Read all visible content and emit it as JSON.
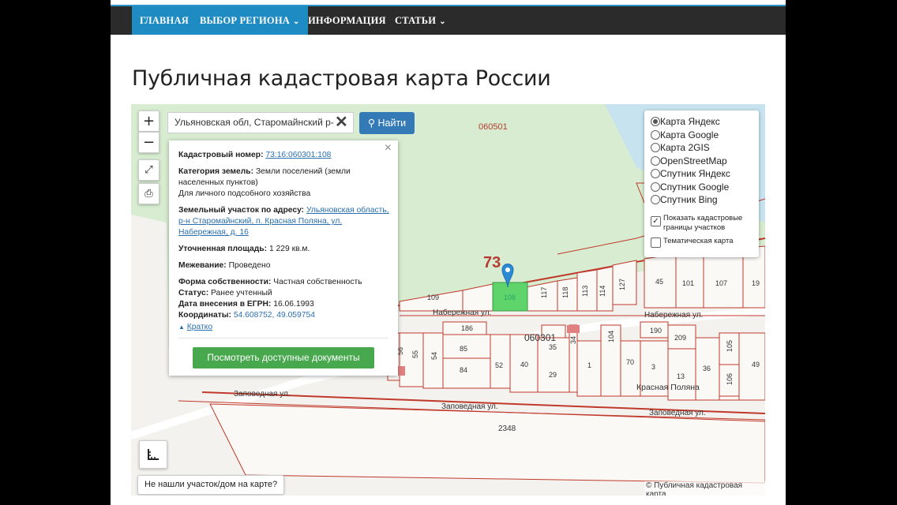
{
  "nav": {
    "items": [
      "ГЛАВНАЯ",
      "ВЫБОР РЕГИОНА",
      "ИНФОРМАЦИЯ",
      "СТАТЬИ"
    ]
  },
  "page": {
    "title": "Публичная кадастровая карта России"
  },
  "map_controls": {
    "zoom_in": "+",
    "zoom_out": "−",
    "search_value": "Ульяновская обл, Старомайнский р-",
    "search_button": "Найти",
    "not_found_button": "Не нашли участок/дом на карте?",
    "attribution": "© Публичная кадастровая карта"
  },
  "info_card": {
    "cadastral_label": "Кадастровый номер:",
    "cadastral_value": "73:16:060301:108",
    "category_label": "Категория земель:",
    "category_value": "Земли поселений (земли",
    "category_value_2": "населенных пунктов)",
    "usage_value": "Для личного подсобного хозяйства",
    "address_label": "Земельный участок по адресу:",
    "address_value_1": "Ульяновская область,",
    "address_value_2": "р-н Старомайнский, п. Красная Поляна, ул.",
    "address_value_3": "Набережная, д. 16",
    "area_label": "Уточненная площадь:",
    "area_value": "1 229 кв.м.",
    "survey_label": "Межевание:",
    "survey_value": "Проведено",
    "ownership_label": "Форма собственности:",
    "ownership_value": "Частная собственность",
    "status_label": "Статус:",
    "status_value": "Ранее учтенный",
    "egrn_label": "Дата внесения в ЕГРН:",
    "egrn_value": "16.06.1993",
    "coords_label": "Координаты:",
    "coords_value": "54.608752, 49.059754",
    "collapse_link": "Кратко",
    "docs_button": "Посмотреть доступные документы",
    "close": "×"
  },
  "layers": {
    "options": [
      "Карта Яндекс",
      "Карта Google",
      "Карта 2GIS",
      "OpenStreetMap",
      "Спутник Яндекс",
      "Спутник Google",
      "Спутник Bing"
    ],
    "selected": "Карта Яндекс",
    "cadastral_borders": "Показать кадастровые границы участков",
    "cadastral_borders_checked": true,
    "thematic_map": "Тематическая карта",
    "thematic_map_checked": false
  },
  "map_labels": {
    "quarter_top": "060501",
    "region_num": "73",
    "quarter_mid": "060301",
    "street_1": "Набережная ул.",
    "street_2": "Набережная ул.",
    "street_3": "Заповедная ул.",
    "street_4": "Заповедная ул.",
    "street_5": "Заповедная ул.",
    "village": "Красная Поляна",
    "big_parcel": "2348",
    "selected_parcel": "108",
    "parcels_row1": [
      "109",
      "117",
      "118",
      "113",
      "114",
      "127",
      "45",
      "101",
      "107",
      "19"
    ],
    "parcels_row2": [
      "186",
      "85",
      "84",
      "52",
      "40",
      "35",
      "29",
      "34",
      "1",
      "104",
      "70",
      "3",
      "190",
      "209",
      "13",
      "36",
      "105",
      "106",
      "49",
      "55",
      "54",
      "56"
    ]
  },
  "colors": {
    "nav_bg": "#2b2b2b",
    "nav_active": "#1e8bc3",
    "parcel_line": "#c0392b",
    "selected_parcel": "#5fd46b",
    "marker": "#2d8bd6",
    "button_green": "#48a84e",
    "button_blue": "#337ab7"
  }
}
